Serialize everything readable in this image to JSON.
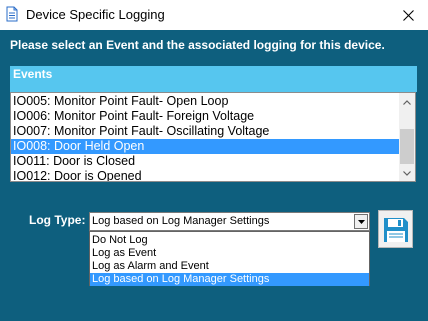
{
  "window": {
    "title": "Device Specific Logging",
    "close_symbol": "X"
  },
  "instruction": "Please select an Event and the associated logging for this device.",
  "events": {
    "header": "Events",
    "items": [
      {
        "label": "IO005: Monitor Point Fault- Open Loop",
        "selected": false
      },
      {
        "label": "IO006: Monitor Point Fault- Foreign Voltage",
        "selected": false
      },
      {
        "label": "IO007: Monitor Point Fault- Oscillating Voltage",
        "selected": false
      },
      {
        "label": "IO008: Door Held Open",
        "selected": true
      },
      {
        "label": "IO011: Door is Closed",
        "selected": false
      },
      {
        "label": "IO012: Door is Opened",
        "selected": false
      }
    ]
  },
  "log_type": {
    "label": "Log Type:",
    "selected_value": "Log based on Log Manager Settings",
    "options": [
      "Do Not Log",
      "Log as Event",
      "Log as Alarm and Event",
      "Log based on Log Manager Settings"
    ],
    "selected_index": 3
  },
  "icons": {
    "title": "document-icon",
    "close": "close-icon",
    "scroll_up": "chevron-up-icon",
    "scroll_down": "chevron-down-icon",
    "dropdown": "chevron-down-icon",
    "save": "floppy-disk-icon"
  },
  "colors": {
    "background": "#0e5f7e",
    "header": "#56c6ef",
    "selection": "#3399ff"
  }
}
